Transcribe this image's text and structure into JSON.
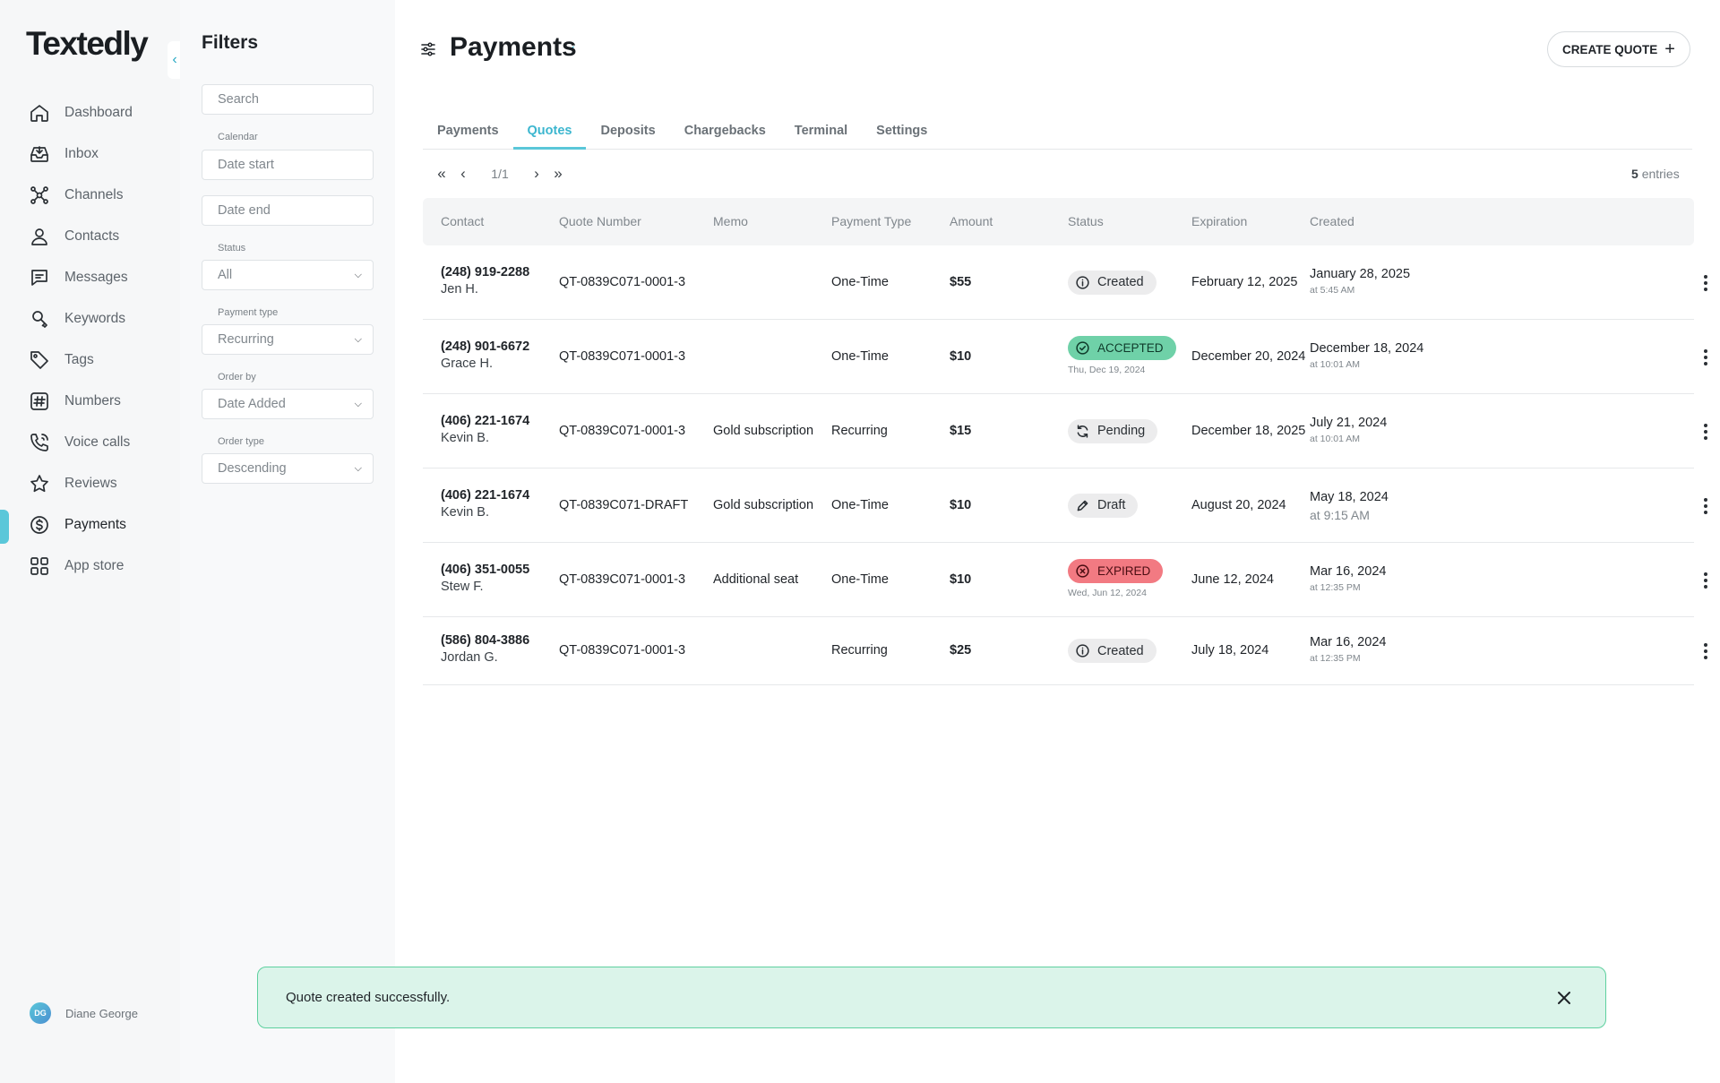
{
  "app": {
    "logo": "Textedly",
    "collapse_icon": "‹"
  },
  "sidebar": {
    "items": [
      {
        "label": "Dashboard",
        "icon": "home-icon"
      },
      {
        "label": "Inbox",
        "icon": "inbox-icon"
      },
      {
        "label": "Channels",
        "icon": "channels-icon"
      },
      {
        "label": "Contacts",
        "icon": "user-icon"
      },
      {
        "label": "Messages",
        "icon": "message-icon"
      },
      {
        "label": "Keywords",
        "icon": "keyword-icon"
      },
      {
        "label": "Tags",
        "icon": "tag-icon"
      },
      {
        "label": "Numbers",
        "icon": "hash-icon"
      },
      {
        "label": "Voice calls",
        "icon": "phone-icon"
      },
      {
        "label": "Reviews",
        "icon": "star-icon"
      },
      {
        "label": "Payments",
        "icon": "dollar-icon",
        "active": true
      },
      {
        "label": "App store",
        "icon": "grid-icon"
      }
    ],
    "user": {
      "initials": "DG",
      "name": "Diane George"
    }
  },
  "filters": {
    "title": "Filters",
    "search_placeholder": "Search",
    "calendar_label": "Calendar",
    "date_start_placeholder": "Date start",
    "date_end_placeholder": "Date end",
    "status_label": "Status",
    "status_value": "All",
    "payment_type_label": "Payment type",
    "payment_type_value": "Recurring",
    "order_by_label": "Order by",
    "order_by_value": "Date Added",
    "order_type_label": "Order type",
    "order_type_value": "Descending"
  },
  "header": {
    "title": "Payments",
    "create_button": "CREATE QUOTE",
    "create_icon": "+"
  },
  "tabs": [
    {
      "label": "Payments"
    },
    {
      "label": "Quotes",
      "active": true
    },
    {
      "label": "Deposits"
    },
    {
      "label": "Chargebacks"
    },
    {
      "label": "Terminal"
    },
    {
      "label": "Settings"
    }
  ],
  "pagination": {
    "first": "«",
    "prev": "‹",
    "page": "1/1",
    "next": "›",
    "last": "»",
    "entries_count": "5",
    "entries_label": "entries"
  },
  "table": {
    "columns": [
      "Contact",
      "Quote Number",
      "Memo",
      "Payment Type",
      "Amount",
      "Status",
      "Expiration",
      "Created"
    ],
    "rows": [
      {
        "phone": "(248) 919-2288",
        "name": "Jen H.",
        "quote": "QT-0839C071-0001-3",
        "memo": "",
        "type": "One-Time",
        "amount": "$55",
        "status": "Created",
        "status_kind": "created",
        "status_sub": "",
        "expiration": "February 12, 2025",
        "created_date": "January 28, 2025",
        "created_time": "at 5:45 AM"
      },
      {
        "phone": "(248) 901-6672",
        "name": "Grace H.",
        "quote": "QT-0839C071-0001-3",
        "memo": "",
        "type": "One-Time",
        "amount": "$10",
        "status": "ACCEPTED",
        "status_kind": "accepted",
        "status_sub": "Thu, Dec 19, 2024",
        "expiration": "December 20, 2024",
        "created_date": "December 18, 2024",
        "created_time": "at 10:01 AM"
      },
      {
        "phone": "(406) 221-1674",
        "name": "Kevin B.",
        "quote": "QT-0839C071-0001-3",
        "memo": "Gold subscription",
        "type": "Recurring",
        "amount": "$15",
        "status": "Pending",
        "status_kind": "pending",
        "status_sub": "",
        "expiration": "December 18, 2025",
        "created_date": "July 21, 2024",
        "created_time": "at 10:01 AM"
      },
      {
        "phone": "(406) 221-1674",
        "name": "Kevin B.",
        "quote": "QT-0839C071-DRAFT",
        "memo": "Gold subscription",
        "type": "One-Time",
        "amount": "$10",
        "status": "Draft",
        "status_kind": "draft",
        "status_sub": "",
        "expiration": "August 20, 2024",
        "created_date": "May 18, 2024",
        "created_time": "at 9:15 AM"
      },
      {
        "phone": "(406) 351-0055",
        "name": "Stew F.",
        "quote": "QT-0839C071-0001-3",
        "memo": "Additional seat",
        "type": "One-Time",
        "amount": "$10",
        "status": "EXPIRED",
        "status_kind": "expired",
        "status_sub": "Wed, Jun 12, 2024",
        "expiration": "June 12, 2024",
        "created_date": "Mar 16, 2024",
        "created_time": "at 12:35 PM"
      },
      {
        "phone": "(586) 804-3886",
        "name": "Jordan G.",
        "quote": "QT-0839C071-0001-3",
        "memo": "",
        "type": "Recurring",
        "amount": "$25",
        "status": "Created",
        "status_kind": "created",
        "status_sub": "",
        "expiration": "July 18, 2024",
        "created_date": "Mar 16, 2024",
        "created_time": "at 12:35 PM"
      }
    ]
  },
  "toast": {
    "message": "Quote created successfully."
  },
  "colors": {
    "accent": "#5ac7d9",
    "accepted": "#6fd1a8",
    "expired": "#f27a82",
    "toast_bg": "#dbf4ea",
    "toast_border": "#5ed09f"
  }
}
